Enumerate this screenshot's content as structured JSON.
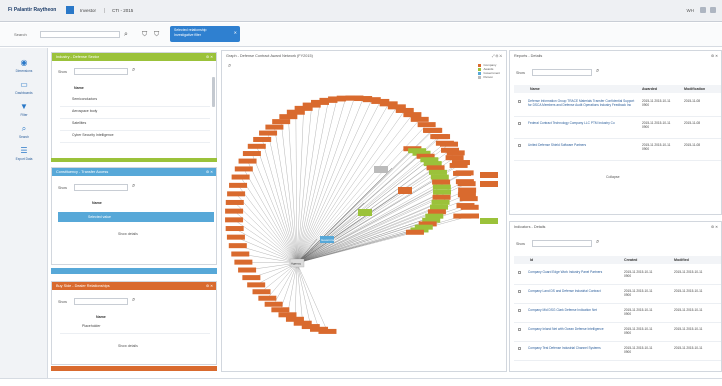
{
  "topbar": {
    "logo": "Fi Palantir Raytheon",
    "breadcrumb1": "Investor",
    "breadcrumb2": "CTI - 2015",
    "right_text": "WH"
  },
  "filterbar": {
    "label": "Search",
    "search_placeholder": "",
    "chip_line1": "Selected relationship",
    "chip_line2": "Investigative filter"
  },
  "leftnav": [
    {
      "label": "Dimensions",
      "icon": "globe-icon",
      "glyph": "◉"
    },
    {
      "label": "Dashboards",
      "icon": "monitor-icon",
      "glyph": "▭"
    },
    {
      "label": "Filter",
      "icon": "filter-icon",
      "glyph": "▼"
    },
    {
      "label": "Search",
      "icon": "search-icon",
      "glyph": "⌕"
    },
    {
      "label": "Export Data",
      "icon": "database-icon",
      "glyph": "☰"
    }
  ],
  "panels": {
    "p1": {
      "title": "Industry - Defense Sector",
      "ctl": "⚙ ✕",
      "filter_label": "Show",
      "filter_value": "",
      "col_header": "Name",
      "rows": [
        "Semiconductors",
        "Aerospace body",
        "Satellites",
        "Cyber Security Intelligence"
      ]
    },
    "p2": {
      "title": "Constituency - Transfer Access",
      "ctl": "⚙ ✕",
      "filter_label": "Show",
      "col_header": "Name",
      "selected": "Selected value",
      "show_more": "Show details"
    },
    "p3": {
      "title": "",
      "ctl": ""
    },
    "p4": {
      "title": "Buy Side - Dealer Relationships",
      "ctl": "⚙ ✕",
      "filter_label": "Show",
      "col_header": "Name",
      "rows": [
        "Placeholder"
      ],
      "show_more": "Show details"
    }
  },
  "graph": {
    "title": "Graph - Defense Contract Award Network (FY2015)",
    "ctl": "⤢ ⚙ ✕",
    "legend": [
      {
        "label": "Company",
        "color": "#d96a2e"
      },
      {
        "label": "Awards",
        "color": "#9bc23a"
      },
      {
        "label": "Government",
        "color": "#57a8d8"
      },
      {
        "label": "Person",
        "color": "#bbbbbb"
      }
    ],
    "center_label": "Government",
    "hub_label": "Agency"
  },
  "reports": {
    "title": "Reports - Details",
    "ctl": "⚙ ✕",
    "filter_label": "Show",
    "columns": [
      "Name",
      "Awarded",
      "Modification"
    ],
    "rows": [
      {
        "name": "Defense Information Group TRACE Materials Transfer Confidential Support for DSCA Members and Defense Audit Operations Industry Feedback Inc",
        "a": "2015-11 2015-10-11 0900",
        "b": "2015-11-08"
      },
      {
        "name": "Federal Contract Technology Company LLC PTM Industry Co",
        "a": "2015-11 2015-10-11 0900",
        "b": "2015-11-08"
      },
      {
        "name": "United Defense Shield Software Partners",
        "a": "2015-11 2015-10-11 0900",
        "b": "2015-11-08"
      }
    ],
    "show_more": "Collapse"
  },
  "indicators": {
    "title": "Indicators - Details",
    "ctl": "⚙ ✕",
    "filter_label": "Show",
    "columns": [
      "Id",
      "Created",
      "Modified"
    ],
    "rows": [
      {
        "name": "Company Guard Edge Work Industry Panel Partners",
        "a": "2015-11 2015-10-11 0900",
        "b": "2015-11 2015-10-11"
      },
      {
        "name": "Company Land DS and Defense Industrial Contract",
        "a": "2015-11 2015-10-11 0900",
        "b": "2015-11 2015-10-11"
      },
      {
        "name": "Company Mid DSG Clark Defense Indication Net",
        "a": "2015-11 2015-10-11 0900",
        "b": "2015-11 2015-10-11"
      },
      {
        "name": "Company Inland Net with Ocean Defense Intelligence",
        "a": "2015-11 2015-10-11 0900",
        "b": "2015-11 2015-10-11"
      },
      {
        "name": "Company Test Defense Industrial Channel Systems",
        "a": "2015-11 2015-10-11 0900",
        "b": "2015-11 2015-10-11"
      }
    ]
  }
}
